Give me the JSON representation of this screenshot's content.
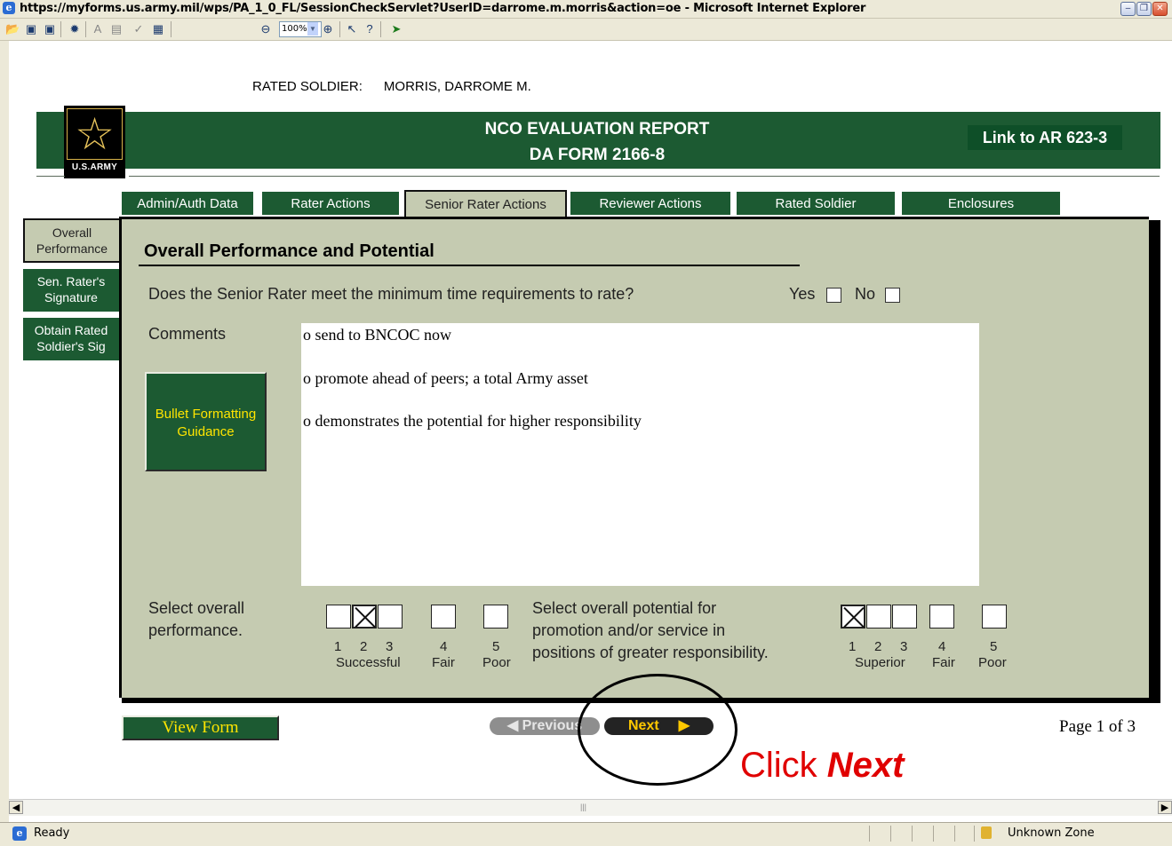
{
  "window": {
    "title": "https://myforms.us.army.mil/wps/PA_1_0_FL/SessionCheckServlet?UserID=darrome.m.morris&action=oe - Microsoft Internet Explorer",
    "zoom": "100%"
  },
  "header": {
    "rated_soldier_label": "RATED SOLDIER:",
    "rated_soldier_name": "MORRIS, DARROME M.",
    "report_title_line1": "NCO EVALUATION REPORT",
    "report_title_line2": "DA FORM 2166-8",
    "ar_link": "Link to AR 623-3",
    "logo_text": "U.S.ARMY",
    "brand_green": "#1c5a32",
    "panel_color": "#c5cbb1"
  },
  "tabs": [
    {
      "label": "Admin/Auth Data",
      "active": false
    },
    {
      "label": "Rater Actions",
      "active": false
    },
    {
      "label": "Senior Rater Actions",
      "active": true
    },
    {
      "label": "Reviewer Actions",
      "active": false
    },
    {
      "label": "Rated Soldier",
      "active": false
    },
    {
      "label": "Enclosures",
      "active": false
    }
  ],
  "sidenav": [
    {
      "line1": "Overall",
      "line2": "Performance",
      "active": true
    },
    {
      "line1": "Sen. Rater's",
      "line2": "Signature",
      "active": false
    },
    {
      "line1": "Obtain Rated",
      "line2": "Soldier's Sig",
      "active": false
    }
  ],
  "section": {
    "title": "Overall Performance and Potential",
    "question": "Does the Senior Rater meet the minimum time requirements to rate?",
    "yes_label": "Yes",
    "no_label": "No",
    "yes_checked": false,
    "no_checked": false,
    "comments_label": "Comments",
    "comments": [
      "o send to BNCOC now",
      "o promote ahead of peers; a total Army asset",
      "o demonstrates the potential for higher responsibility"
    ],
    "bullet_button_line1": "Bullet Formatting",
    "bullet_button_line2": "Guidance"
  },
  "performance": {
    "label_line1": "Select overall",
    "label_line2": "performance.",
    "numbers": [
      "1",
      "2",
      "3",
      "4",
      "5"
    ],
    "captions": [
      "Successful",
      "Fair",
      "Poor"
    ],
    "selected": 2
  },
  "potential": {
    "label_line1": "Select overall potential for",
    "label_line2": "promotion and/or service in",
    "label_line3": "positions of greater responsibility.",
    "numbers": [
      "1",
      "2",
      "3",
      "4",
      "5"
    ],
    "captions": [
      "Superior",
      "Fair",
      "Poor"
    ],
    "selected": 1
  },
  "footer": {
    "view_form": "View Form",
    "previous": "Previous",
    "next": "Next",
    "page_count": "Page 1 of 3",
    "annotation_prefix": "Click ",
    "annotation_emphasis": "Next"
  },
  "status": {
    "text": "Ready",
    "zone": "Unknown Zone"
  }
}
